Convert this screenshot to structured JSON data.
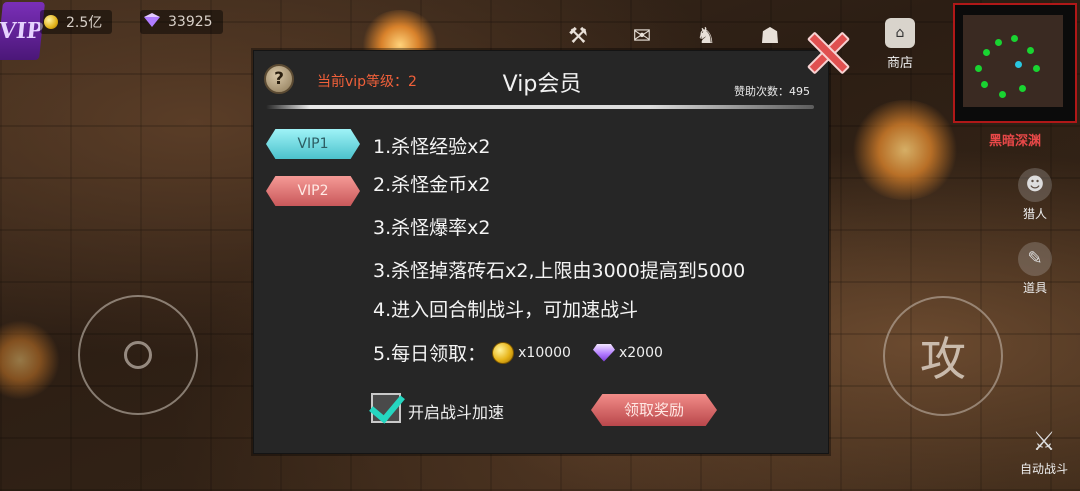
{
  "hud": {
    "vip_badge": "VIP",
    "gold": "2.5亿",
    "diamonds": "33925",
    "shop_label": "商店",
    "map_name": "黑暗深渊",
    "hunter_label": "猎人",
    "items_label": "道具",
    "attack_label": "攻",
    "auto_fight_label": "自动战斗",
    "top_icons": [
      "hammer-wrench-icon",
      "ticket-icon",
      "beast-head-icon",
      "helmet-icon"
    ]
  },
  "dialog": {
    "help_label": "?",
    "current_level_label": "当前vip等级：2",
    "title": "Vip会员",
    "sponsor_count": "赞助次数：495",
    "tabs": [
      {
        "label": "VIP1"
      },
      {
        "label": "VIP2"
      }
    ],
    "perks": [
      "1.杀怪经验x2",
      "2.杀怪金币x2",
      "3.杀怪爆率x2",
      "3.杀怪掉落砖石x2,上限由3000提高到5000",
      "4.进入回合制战斗，可加速战斗"
    ],
    "daily_reward_label": "5.每日领取：",
    "daily_gold_qty": "x10000",
    "daily_gem_qty": "x2000",
    "speed_checkbox_label": "开启战斗加速",
    "speed_checked": true,
    "claim_button": "领取奖励"
  },
  "colors": {
    "dialog_bg": "#262626",
    "current_level_text": "#f0603a",
    "vip1_tab": "#6fdbe2",
    "vip2_tab": "#de6f70",
    "claim_button": "#d46a6a",
    "checkmark": "#25d6c0",
    "minimap_border": "#b01818",
    "map_name": "#e84848"
  }
}
